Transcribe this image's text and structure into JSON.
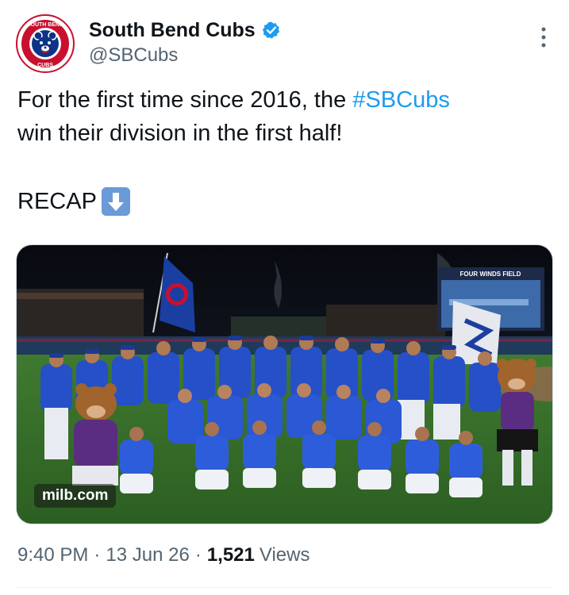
{
  "author": {
    "display_name": "South Bend Cubs",
    "handle": "@SBCubs",
    "verified": true,
    "avatar_icon": "cubs-logo-icon",
    "avatar_text_top": "SOUTH BEND",
    "avatar_text_bottom": "CUBS"
  },
  "tweet": {
    "text_line1_before": "For the first time since 2016, the ",
    "hashtag": "#SBCubs",
    "text_line2": "win their division in the first half!",
    "recap": "RECAP",
    "recap_emoji": "down-arrow-emoji-icon"
  },
  "media": {
    "watermark": "milb.com",
    "scoreboard_text": "FOUR WINDS FIELD",
    "description_icon": "team-celebration-photo"
  },
  "meta": {
    "time": "9:40 PM",
    "date": "13 Jun 26",
    "views_count": "1,521",
    "views_label": "Views",
    "separator": "·"
  },
  "colors": {
    "link": "#1d9bf0",
    "secondary_text": "#536471",
    "primary_text": "#0f1419",
    "cubs_blue": "#0e3386",
    "cubs_red": "#c8102e"
  }
}
